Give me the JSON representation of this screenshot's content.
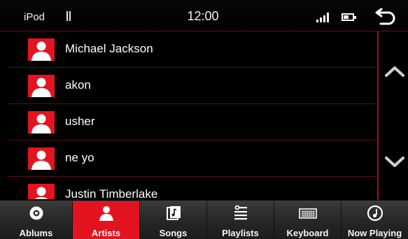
{
  "status": {
    "source": "iPod",
    "clock": "12:00",
    "battery_level": 0.6
  },
  "list": {
    "items": [
      {
        "name": "Michael Jackson"
      },
      {
        "name": "akon"
      },
      {
        "name": "usher"
      },
      {
        "name": "ne yo"
      },
      {
        "name": "Justin Timberlake"
      }
    ]
  },
  "tabs": [
    {
      "label": "Ablums",
      "icon": "disc-icon",
      "active": false
    },
    {
      "label": "Artists",
      "icon": "person-icon",
      "active": true
    },
    {
      "label": "Songs",
      "icon": "music-note-icon",
      "active": false
    },
    {
      "label": "Playlists",
      "icon": "playlist-icon",
      "active": false
    },
    {
      "label": "Keyboard",
      "icon": "keyboard-icon",
      "active": false
    },
    {
      "label": "Now Playing",
      "icon": "now-playing-icon",
      "active": false
    }
  ],
  "colors": {
    "accent": "#e3131f",
    "divider": "#5c0c12",
    "background": "#000000"
  }
}
